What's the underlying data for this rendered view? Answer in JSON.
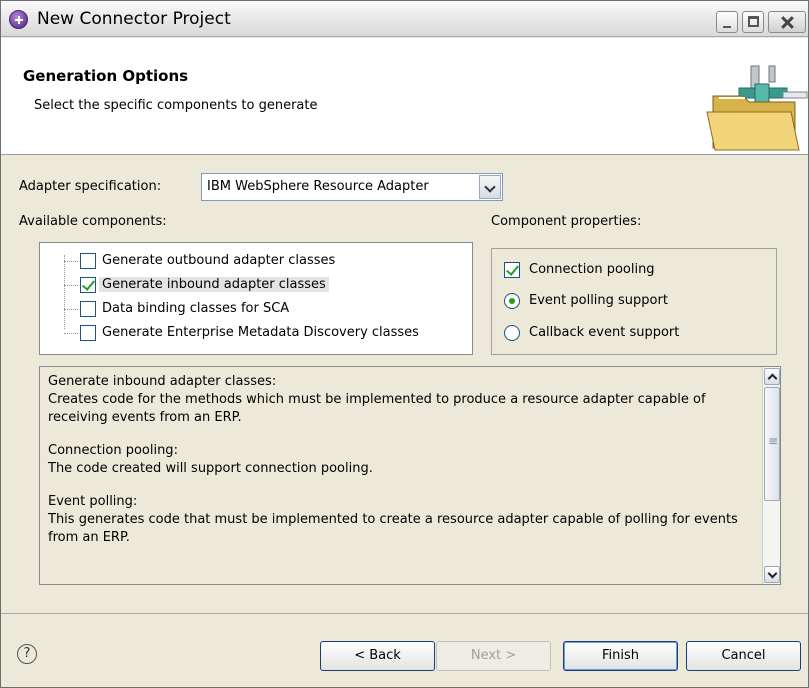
{
  "window": {
    "title": "New Connector Project"
  },
  "banner": {
    "title": "Generation Options",
    "description": "Select the specific components to generate"
  },
  "adapter_spec": {
    "label": "Adapter specification:",
    "value": "IBM WebSphere Resource Adapter"
  },
  "components": {
    "label": "Available components:",
    "items": [
      {
        "label": "Generate outbound adapter classes",
        "checked": false
      },
      {
        "label": "Generate inbound adapter classes",
        "checked": true
      },
      {
        "label": "Data binding classes for SCA",
        "checked": false
      },
      {
        "label": "Generate Enterprise Metadata Discovery classes",
        "checked": false
      }
    ]
  },
  "properties": {
    "label": "Component properties:",
    "connection_pooling": {
      "label": "Connection pooling",
      "checked": true
    },
    "event_polling": {
      "label": "Event polling support",
      "selected": true
    },
    "callback_event": {
      "label": "Callback event support",
      "selected": false
    }
  },
  "description": {
    "p1": "Generate inbound adapter classes:\nCreates code for the methods which must be implemented to produce a resource adapter capable of receiving events from an ERP.",
    "p2": "Connection pooling:\nThe code created will support connection pooling.",
    "p3": "Event polling:\nThis generates code that must be implemented to create a resource adapter capable of polling for events from an ERP."
  },
  "buttons": {
    "help": "?",
    "back": "< Back",
    "next": "Next >",
    "finish": "Finish",
    "cancel": "Cancel"
  },
  "colors": {
    "dialog_bg": "#ece9d8",
    "check_green": "#21a121",
    "border_blue": "#1c5180"
  }
}
